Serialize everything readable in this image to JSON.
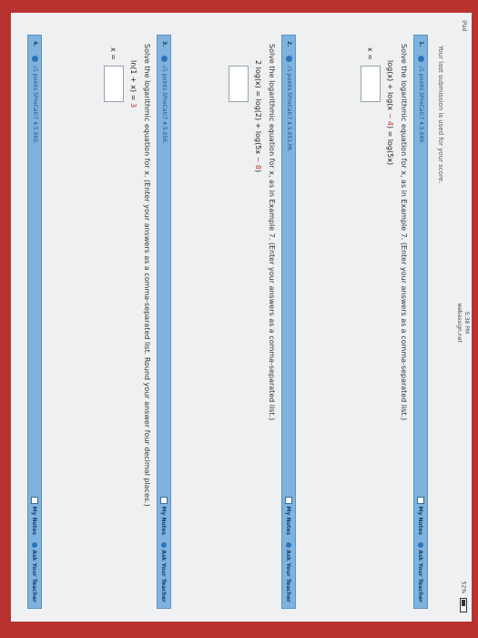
{
  "status": {
    "device": "iPad",
    "time": "5:38 PM",
    "url": "webassign.net",
    "battery": "52%"
  },
  "notice": "Your last submission is used for your score.",
  "actions": {
    "my_notes": "My Notes",
    "ask_teacher": "Ask Your Teacher"
  },
  "questions": [
    {
      "number": "1.",
      "points": "-/1 points  SPreCalc7 4.5.049.",
      "instruction": "Solve the logarithmic equation for x, as in Example 7. (Enter your answers as a comma-separated list.)",
      "equation_pre": "log(x) + log(x ",
      "equation_red": "− 4",
      "equation_post": ") = log(5x)",
      "answer_label": "x ="
    },
    {
      "number": "2.",
      "points": "-/1 points  SPreCalc7 4.5.051.MI.",
      "instruction": "Solve the logarithmic equation for x, as in Example 7. (Enter your answers as a comma-separated list.)",
      "equation_pre": "2 log(x) = log(2) + log(5x ",
      "equation_red": "− 8",
      "equation_post": ")",
      "answer_label": ""
    },
    {
      "number": "3.",
      "points": "-/1 points  SPreCalc7 4.5.056.",
      "instruction": "Solve the logarithmic equation for x. (Enter your answers as a comma-separated list. Round your answer four decimal places.)",
      "equation_pre": "ln(1 + x) = ",
      "equation_red": "3",
      "equation_post": "",
      "answer_label": "x ="
    },
    {
      "number": "4.",
      "points": "-/1 points  SPreCalc7 4.5.060.",
      "instruction": "",
      "equation_pre": "",
      "equation_red": "",
      "equation_post": "",
      "answer_label": ""
    }
  ]
}
